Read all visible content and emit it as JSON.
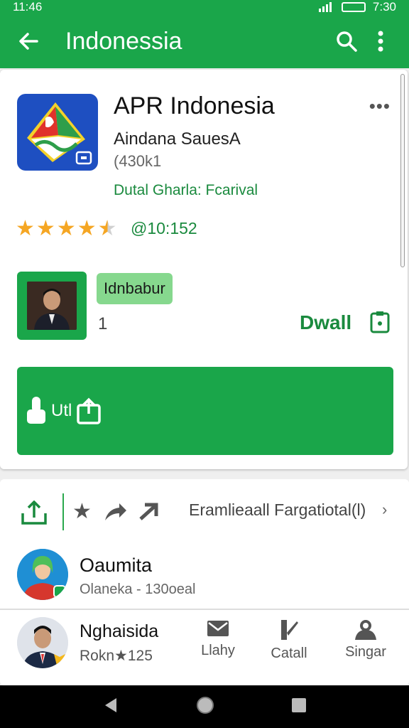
{
  "status_bar": {
    "time_left": "11:46",
    "time_right": "7:30"
  },
  "app_bar": {
    "title": "Indonessia",
    "icons": [
      "back-arrow-icon",
      "search-icon",
      "more-vert-icon"
    ]
  },
  "app": {
    "name": "APR Indonesia",
    "developer": "Aindana SauesA",
    "size": "(430k1",
    "category": "Dutal Gharla: Fcarival",
    "rating_stars": 4.5,
    "rating_count": "@10:152",
    "chip_label": "Idnbabur",
    "count": "1",
    "dwall_label": "Dwall",
    "button_label": "Utl",
    "colors": {
      "primary": "#1aa64a",
      "dark_green": "#1a8a3e",
      "star": "#f5a623"
    }
  },
  "actions": {
    "breadcrumb": "Eramlieaall Fargatiotal(l)"
  },
  "users": [
    {
      "name": "Oaumita",
      "subtitle": "Olaneka - 130oeal"
    },
    {
      "name": "Nghaisida",
      "subtitle": "Rokn★125"
    }
  ],
  "tabs": [
    {
      "label": "Llahy",
      "icon": "mail-icon"
    },
    {
      "label": "Catall",
      "icon": "download-icon"
    },
    {
      "label": "Singar",
      "icon": "person-icon"
    }
  ]
}
